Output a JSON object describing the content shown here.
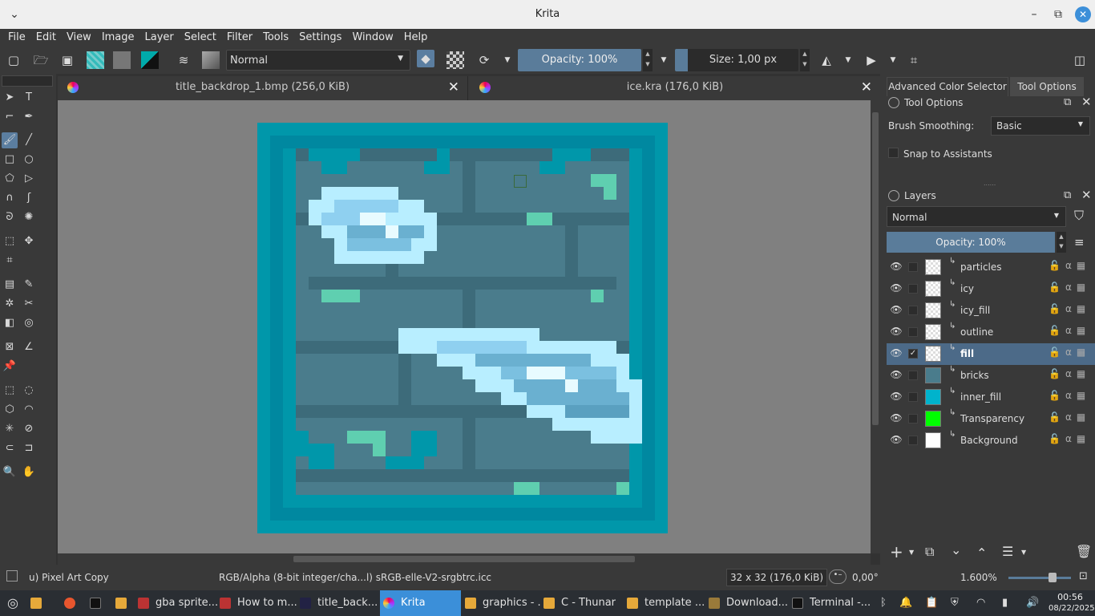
{
  "window": {
    "title": "Krita"
  },
  "menu": [
    "File",
    "Edit",
    "View",
    "Image",
    "Layer",
    "Select",
    "Filter",
    "Tools",
    "Settings",
    "Window",
    "Help"
  ],
  "toolbar": {
    "blend_mode": "Normal",
    "opacity": "Opacity: 100%",
    "size": "Size: 1,00 px"
  },
  "tabs": [
    {
      "name": "title_backdrop_1.bmp (256,0 KiB)"
    },
    {
      "name": "ice.kra (176,0 KiB)"
    }
  ],
  "tool_options": {
    "dock_tabs": [
      "Advanced Color Selector",
      "Tool Options"
    ],
    "header": "Tool Options",
    "smoothing_label": "Brush Smoothing:",
    "smoothing_value": "Basic",
    "snap_label": "Snap to Assistants"
  },
  "layers_panel": {
    "header": "Layers",
    "blend_mode": "Normal",
    "opacity": "Opacity:  100%",
    "layers": [
      {
        "name": "particles",
        "selected": false,
        "thumb": "transparent"
      },
      {
        "name": "icy",
        "selected": false,
        "thumb": "transparent"
      },
      {
        "name": "icy_fill",
        "selected": false,
        "thumb": "transparent"
      },
      {
        "name": "outline",
        "selected": false,
        "thumb": "transparent"
      },
      {
        "name": "fill",
        "selected": true,
        "thumb": "transparent"
      },
      {
        "name": "bricks",
        "selected": false,
        "thumb": "#4a7c8c"
      },
      {
        "name": "inner_fill",
        "selected": false,
        "thumb": "#00b3cc"
      },
      {
        "name": "Transparency",
        "selected": false,
        "thumb": "#00ff00"
      },
      {
        "name": "Background",
        "selected": false,
        "thumb": "#ffffff"
      }
    ]
  },
  "status": {
    "preset": "u) Pixel Art Copy",
    "color_space": "RGB/Alpha (8-bit integer/cha...l)  sRGB-elle-V2-srgbtrc.icc",
    "dims": "32 x 32 (176,0 KiB)",
    "rotation": "0,00°",
    "zoom": "1.600%"
  },
  "taskbar": {
    "items": [
      "gba sprite...",
      "How to m...",
      "title_back...",
      "Krita",
      "graphics - ...",
      "C - Thunar",
      "template ...",
      "Download...",
      "Terminal -..."
    ],
    "time": "00:56",
    "date": "08/22/2025"
  },
  "colors": {
    "accent": "#5b7ea0",
    "canvas_bg": "#808080",
    "tile_bg": "#0097aa"
  }
}
